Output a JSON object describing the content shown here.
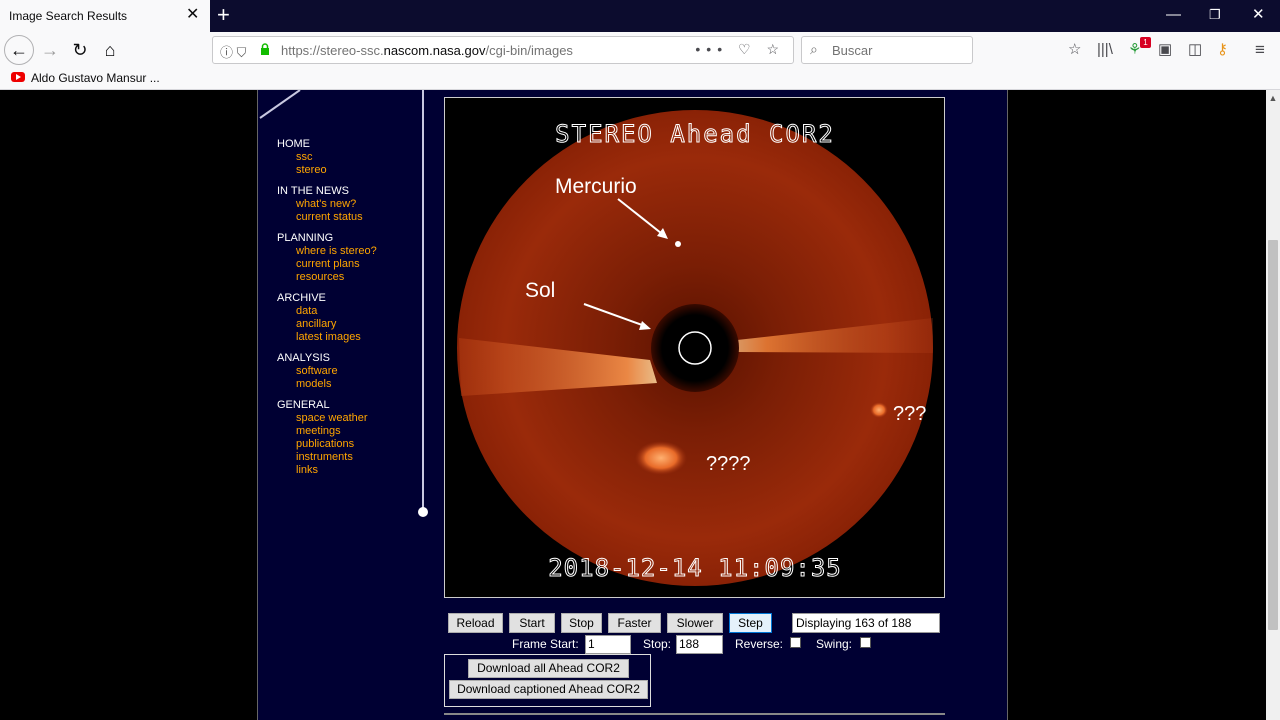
{
  "browser": {
    "tab_title": "Image Search Results",
    "url_prefix": "https://stereo-ssc.",
    "url_domain": "nascom.nasa.gov",
    "url_path": "/cgi-bin/images",
    "search_placeholder": "Buscar",
    "bookmark": "Aldo Gustavo Mansur ...",
    "badge_count": "1"
  },
  "sidebar": {
    "sections": [
      {
        "title": "HOME",
        "links": [
          "ssc",
          "stereo"
        ]
      },
      {
        "title": "IN THE NEWS",
        "links": [
          "what's new?",
          "current status"
        ]
      },
      {
        "title": "PLANNING",
        "links": [
          "where is stereo?",
          "current plans",
          "resources"
        ]
      },
      {
        "title": "ARCHIVE",
        "links": [
          "data",
          "ancillary",
          "latest images"
        ]
      },
      {
        "title": "ANALYSIS",
        "links": [
          "software",
          "models"
        ]
      },
      {
        "title": "GENERAL",
        "links": [
          "space weather",
          "meetings",
          "publications",
          "instruments",
          "links"
        ]
      }
    ]
  },
  "image": {
    "title": "STEREO Ahead COR2",
    "timestamp": "2018-12-14 11:09:35",
    "labels": {
      "mercury": "Mercurio",
      "sun": "Sol",
      "unknown_right": "???",
      "unknown_bottom": "????"
    }
  },
  "controls": {
    "buttons": [
      "Reload",
      "Start",
      "Stop",
      "Faster",
      "Slower",
      "Step"
    ],
    "display_text": "Displaying 163 of 188",
    "frame_start_label": "Frame Start:",
    "frame_start_value": "1",
    "stop_label": "Stop:",
    "stop_value": "188",
    "reverse_label": "Reverse:",
    "swing_label": "Swing:"
  },
  "downloads": {
    "all_label": "Download all Ahead COR2",
    "captioned_label": "Download captioned Ahead COR2"
  }
}
